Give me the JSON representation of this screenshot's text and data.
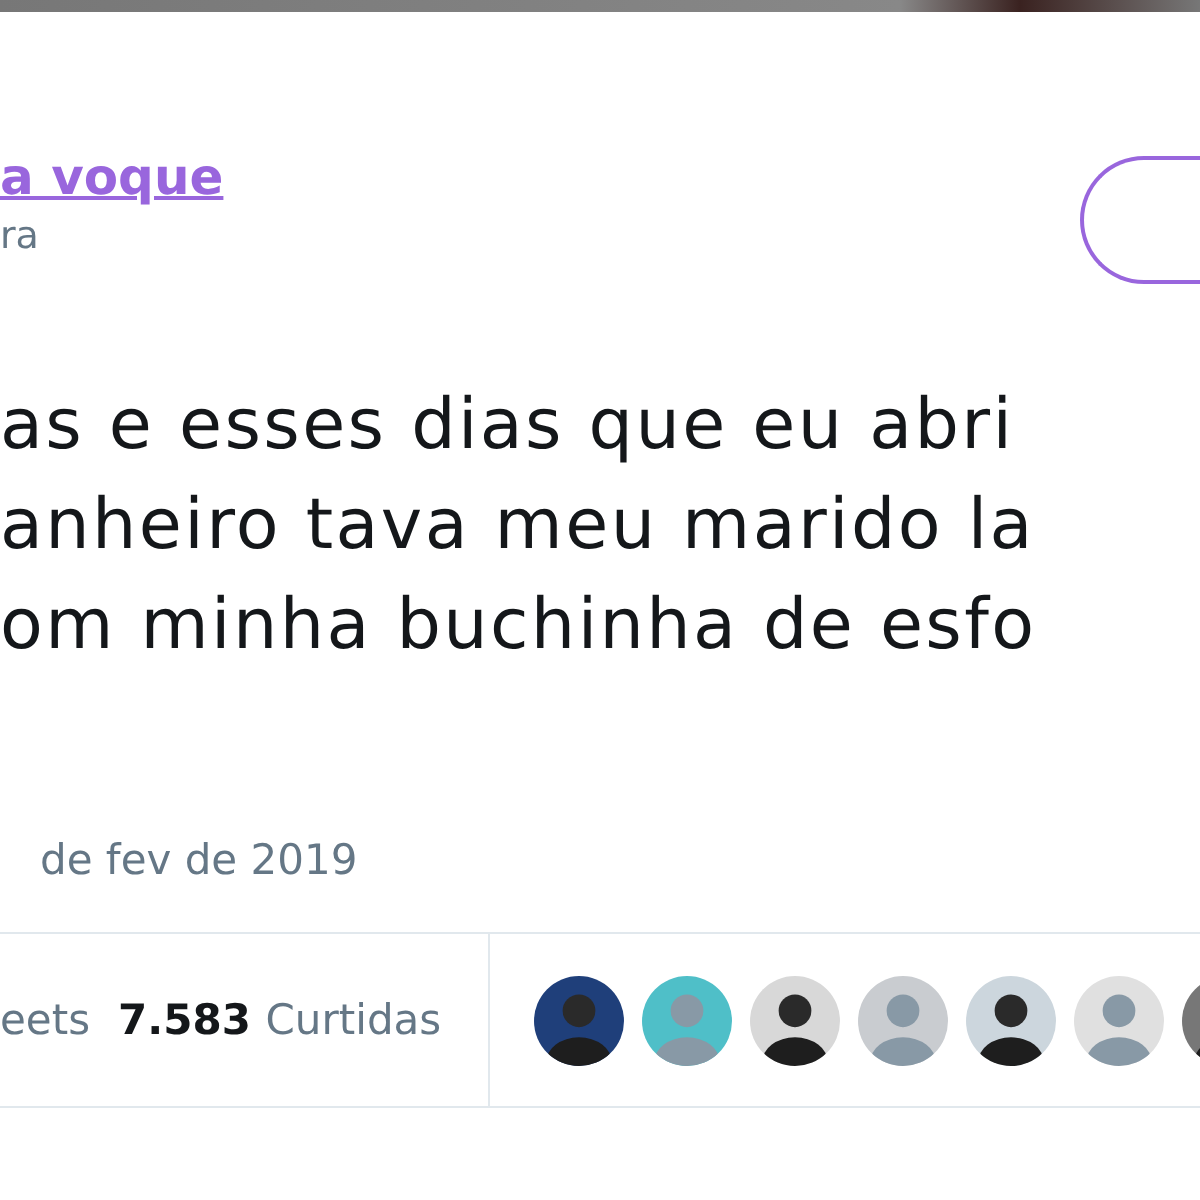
{
  "author": {
    "name": "a voque",
    "handle": "ra"
  },
  "tweet": {
    "lines": [
      "as e esses dias que eu abri",
      "anheiro tava meu marido la",
      "om minha buchinha de esfo"
    ]
  },
  "date": "de fev de 2019",
  "stats": [
    {
      "label": "eets"
    },
    {
      "count": "7.583",
      "label": "Curtidas"
    }
  ],
  "likers": [
    {
      "color": "#1f3f7a"
    },
    {
      "color": "#4fbfc8"
    },
    {
      "color": "#d8d8d8"
    },
    {
      "color": "#c9ccd0"
    },
    {
      "color": "#ccd6dd"
    },
    {
      "color": "#e0e0e0"
    },
    {
      "color": "#777777"
    }
  ]
}
